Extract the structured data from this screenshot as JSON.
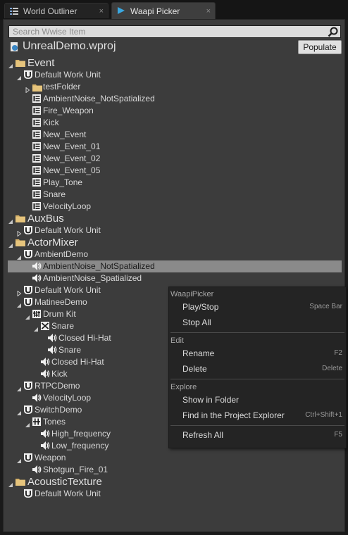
{
  "tabs": [
    {
      "label": "World Outliner",
      "close": "×",
      "active": false
    },
    {
      "label": "Waapi Picker",
      "close": "×",
      "active": true
    }
  ],
  "search": {
    "placeholder": "Search Wwise Item"
  },
  "project": {
    "title": "UnrealDemo.wproj",
    "populate_label": "Populate"
  },
  "tree": [
    {
      "label": "Event",
      "icon": "folder-icon",
      "level": 0,
      "arrow": "expanded",
      "big": true
    },
    {
      "label": "Default Work Unit",
      "icon": "work-unit-icon",
      "level": 1,
      "arrow": "expanded"
    },
    {
      "label": "testFolder",
      "icon": "folder-icon",
      "level": 2,
      "arrow": "collapsed"
    },
    {
      "label": "AmbientNoise_NotSpatialized",
      "icon": "event-icon",
      "level": 2
    },
    {
      "label": "Fire_Weapon",
      "icon": "event-icon",
      "level": 2
    },
    {
      "label": "Kick",
      "icon": "event-icon",
      "level": 2
    },
    {
      "label": "New_Event",
      "icon": "event-icon",
      "level": 2
    },
    {
      "label": "New_Event_01",
      "icon": "event-icon",
      "level": 2
    },
    {
      "label": "New_Event_02",
      "icon": "event-icon",
      "level": 2
    },
    {
      "label": "New_Event_05",
      "icon": "event-icon",
      "level": 2
    },
    {
      "label": "Play_Tone",
      "icon": "event-icon",
      "level": 2
    },
    {
      "label": "Snare",
      "icon": "event-icon",
      "level": 2
    },
    {
      "label": "VelocityLoop",
      "icon": "event-icon",
      "level": 2
    },
    {
      "label": "AuxBus",
      "icon": "folder-icon",
      "level": 0,
      "arrow": "expanded",
      "big": true
    },
    {
      "label": "Default Work Unit",
      "icon": "work-unit-icon",
      "level": 1,
      "arrow": "collapsed"
    },
    {
      "label": "ActorMixer",
      "icon": "folder-icon",
      "level": 0,
      "arrow": "expanded",
      "big": true
    },
    {
      "label": "AmbientDemo",
      "icon": "work-unit-icon",
      "level": 1,
      "arrow": "expanded"
    },
    {
      "label": "AmbientNoise_NotSpatialized",
      "icon": "sound-icon",
      "level": 2,
      "selected": true
    },
    {
      "label": "AmbientNoise_Spatialized",
      "icon": "sound-icon",
      "level": 2
    },
    {
      "label": "Default Work Unit",
      "icon": "work-unit-icon",
      "level": 1,
      "arrow": "collapsed"
    },
    {
      "label": "MatineeDemo",
      "icon": "work-unit-icon",
      "level": 1,
      "arrow": "expanded"
    },
    {
      "label": "Drum Kit",
      "icon": "actor-mixer-icon",
      "level": 2,
      "arrow": "expanded"
    },
    {
      "label": "Snare",
      "icon": "random-container-icon",
      "level": 3,
      "arrow": "expanded"
    },
    {
      "label": "Closed Hi-Hat",
      "icon": "sound-icon",
      "level": 4
    },
    {
      "label": "Snare",
      "icon": "sound-icon",
      "level": 4
    },
    {
      "label": "Closed Hi-Hat",
      "icon": "sound-icon",
      "level": 3
    },
    {
      "label": "Kick",
      "icon": "sound-icon",
      "level": 3
    },
    {
      "label": "RTPCDemo",
      "icon": "work-unit-icon",
      "level": 1,
      "arrow": "expanded"
    },
    {
      "label": "VelocityLoop",
      "icon": "sound-icon",
      "level": 2
    },
    {
      "label": "SwitchDemo",
      "icon": "work-unit-icon",
      "level": 1,
      "arrow": "expanded"
    },
    {
      "label": "Tones",
      "icon": "switch-container-icon",
      "level": 2,
      "arrow": "expanded"
    },
    {
      "label": "High_frequency",
      "icon": "sound-icon",
      "level": 3
    },
    {
      "label": "Low_frequency",
      "icon": "sound-icon",
      "level": 3
    },
    {
      "label": "Weapon",
      "icon": "work-unit-icon",
      "level": 1,
      "arrow": "expanded"
    },
    {
      "label": "Shotgun_Fire_01",
      "icon": "sound-icon",
      "level": 2
    },
    {
      "label": "AcousticTexture",
      "icon": "folder-icon",
      "level": 0,
      "arrow": "expanded",
      "big": true
    },
    {
      "label": "Default Work Unit",
      "icon": "work-unit-icon",
      "level": 1
    }
  ],
  "context_menu": {
    "sections": [
      {
        "title": "WaapiPicker",
        "items": [
          {
            "label": "Play/Stop",
            "shortcut": "Space Bar"
          },
          {
            "label": "Stop All",
            "shortcut": ""
          }
        ]
      },
      {
        "title": "Edit",
        "items": [
          {
            "label": "Rename",
            "shortcut": "F2"
          },
          {
            "label": "Delete",
            "shortcut": "Delete"
          }
        ]
      },
      {
        "title": "Explore",
        "items": [
          {
            "label": "Show in Folder",
            "shortcut": ""
          },
          {
            "label": "Find in the Project Explorer",
            "shortcut": "Ctrl+Shift+1"
          }
        ]
      },
      {
        "title": "",
        "items": [
          {
            "label": "Refresh All",
            "shortcut": "F5"
          }
        ]
      }
    ]
  }
}
